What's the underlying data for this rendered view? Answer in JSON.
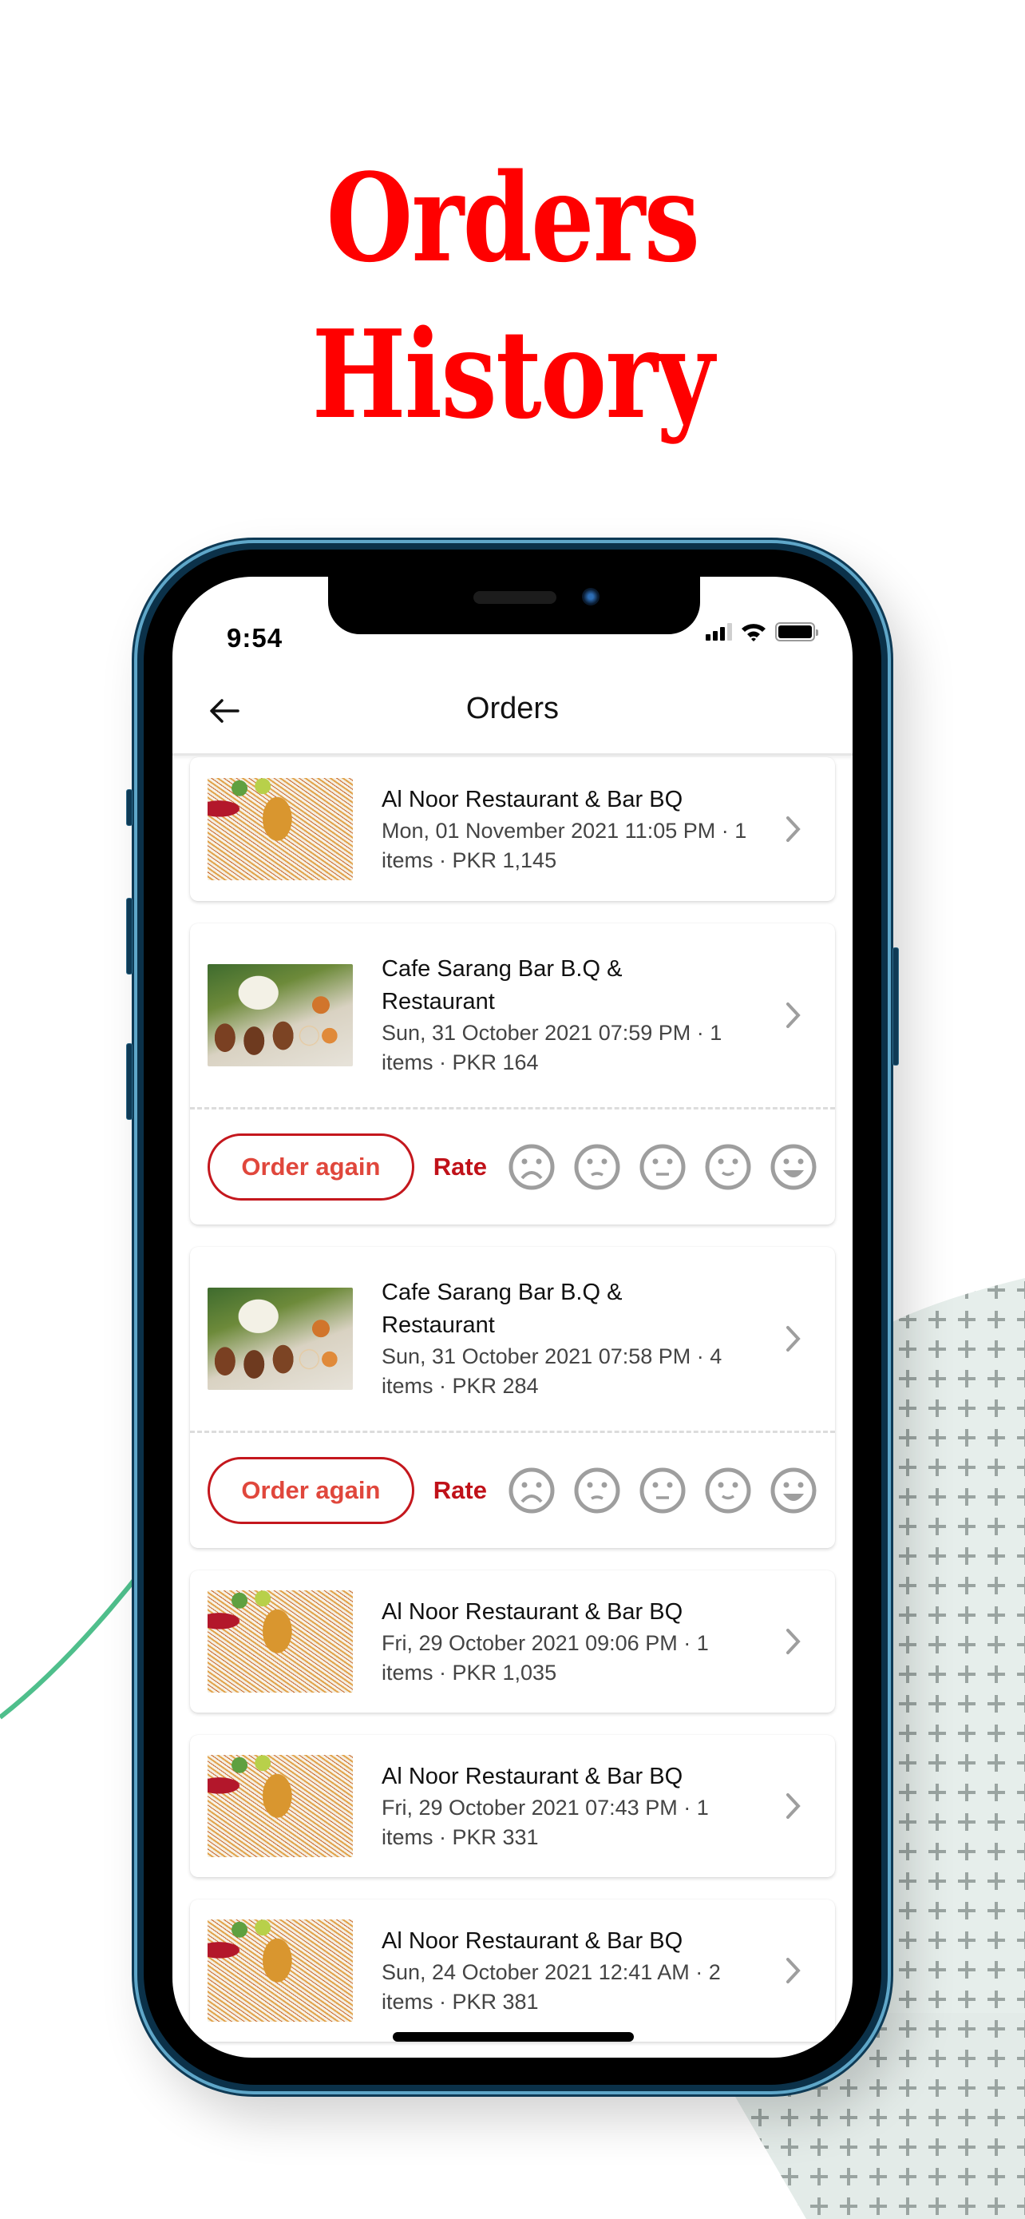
{
  "promo": {
    "headline_line1": "Orders",
    "headline_line2": "History",
    "headline_color": "#ff0000"
  },
  "status_bar": {
    "time": "9:54",
    "icons": [
      "cellular-signal-icon",
      "wifi-icon",
      "battery-icon"
    ]
  },
  "header": {
    "title": "Orders",
    "back_icon": "arrow-left-icon"
  },
  "colors": {
    "accent": "#c4171d",
    "order_again_text": "#e0473c",
    "rate_text": "#c01119",
    "face_icon": "#9e9e9e",
    "chevron": "#9e9e9e"
  },
  "rating_faces": [
    "very-sad-face-icon",
    "sad-face-icon",
    "neutral-face-icon",
    "happy-face-icon",
    "very-happy-face-icon"
  ],
  "orders": [
    {
      "restaurant": "Al Noor Restaurant & Bar BQ",
      "meta": "Mon, 01 November 2021  11:05 PM · 1 items · PKR 1,145",
      "image": "biryani",
      "has_actions": false
    },
    {
      "restaurant": "Cafe Sarang Bar B.Q & Restaurant",
      "meta": "Sun, 31 October 2021  07:59 PM · 1 items · PKR 164",
      "image": "bbq",
      "has_actions": true,
      "order_again_label": "Order again",
      "rate_label": "Rate"
    },
    {
      "restaurant": "Cafe Sarang Bar B.Q & Restaurant",
      "meta": "Sun, 31 October 2021  07:58 PM · 4 items · PKR 284",
      "image": "bbq",
      "has_actions": true,
      "order_again_label": "Order again",
      "rate_label": "Rate"
    },
    {
      "restaurant": "Al Noor Restaurant & Bar BQ",
      "meta": "Fri, 29 October 2021  09:06 PM · 1 items · PKR 1,035",
      "image": "biryani",
      "has_actions": false
    },
    {
      "restaurant": "Al Noor Restaurant & Bar BQ",
      "meta": "Fri, 29 October 2021  07:43 PM · 1 items · PKR 331",
      "image": "biryani",
      "has_actions": false
    },
    {
      "restaurant": "Al Noor Restaurant & Bar BQ",
      "meta": "Sun, 24 October 2021  12:41 AM · 2 items · PKR 381",
      "image": "biryani",
      "has_actions": false
    }
  ]
}
